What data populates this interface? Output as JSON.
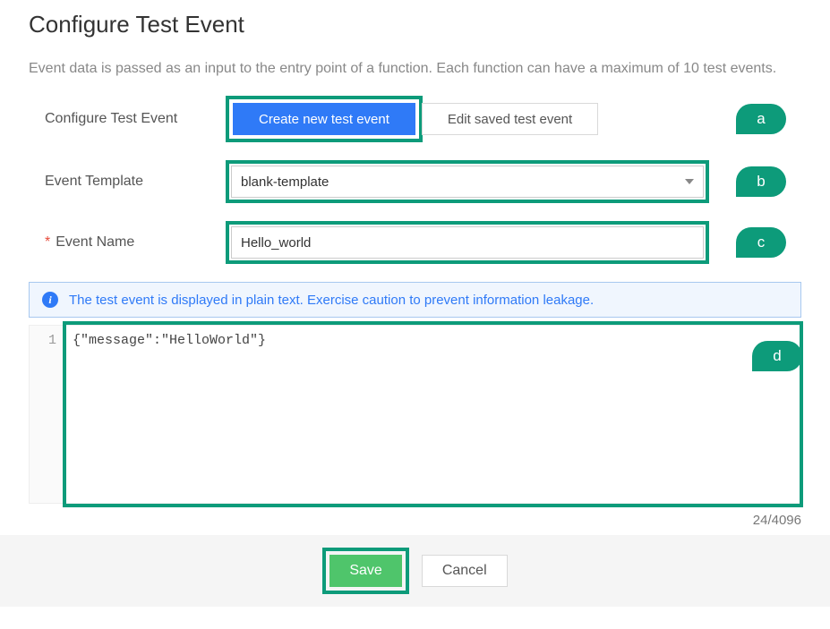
{
  "title": "Configure Test Event",
  "description": "Event data is passed as an input to the entry point of a function. Each function can have a maximum of 10 test events.",
  "labels": {
    "configure": "Configure Test Event",
    "template": "Event Template",
    "name": "Event Name"
  },
  "toggle": {
    "create": "Create new test event",
    "edit": "Edit saved test event"
  },
  "template_value": "blank-template",
  "name_value": "Hello_world",
  "info_text": "The test event is displayed in plain text. Exercise caution to prevent information leakage.",
  "editor": {
    "line_number": "1",
    "content": "{\"message\":\"HelloWorld\"}"
  },
  "char_count": "24/4096",
  "callouts": {
    "a": "a",
    "b": "b",
    "c": "c",
    "d": "d"
  },
  "buttons": {
    "save": "Save",
    "cancel": "Cancel"
  }
}
